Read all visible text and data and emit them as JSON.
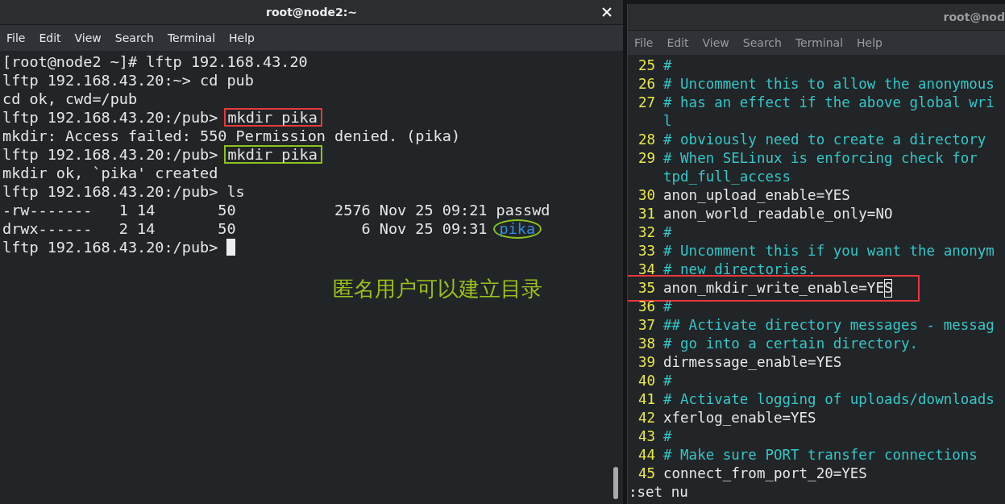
{
  "left_window": {
    "title": "root@node2:~",
    "menu": [
      "File",
      "Edit",
      "View",
      "Search",
      "Terminal",
      "Help"
    ],
    "lines": [
      {
        "text": "[root@node2 ~]# lftp 192.168.43.20"
      },
      {
        "text": "lftp 192.168.43.20:~> cd pub"
      },
      {
        "text": "cd ok, cwd=/pub"
      },
      {
        "text": "lftp 192.168.43.20:/pub> ",
        "command": "mkdir pika",
        "color": "#e8383d"
      },
      {
        "text": "mkdir: Access failed: 550 Permission denied. (pika)"
      },
      {
        "text": "lftp 192.168.43.20:/pub> ",
        "command": "mkdir pika",
        "color": "#8cc21e"
      },
      {
        "text": "mkdir ok, `pika' created"
      },
      {
        "text": "lftp 192.168.43.20:/pub> ls"
      },
      {
        "text": "-rw-------   1 14       50           2576 Nov 25 09:21 passwd"
      },
      {
        "text": "drwx------   2 14       50              6 Nov 25 09:31 ",
        "entry": "pika",
        "color": "#8cc21e"
      },
      {
        "text": "lftp 192.168.43.20:/pub> ",
        "cursor": true
      }
    ],
    "annotation": "匿名用户可以建立目录"
  },
  "right_window": {
    "title": "root@nod",
    "menu": [
      "File",
      "Edit",
      "View",
      "Search",
      "Terminal",
      "Help"
    ],
    "lines": [
      {
        "num": "25",
        "kind": "comment",
        "text": "#"
      },
      {
        "num": "26",
        "kind": "comment",
        "text": "# Uncomment this to allow the anonymous"
      },
      {
        "num": "27",
        "kind": "comment",
        "text": "# has an effect if the above global wri",
        "wrap": "l"
      },
      {
        "num": "28",
        "kind": "comment",
        "text": "# obviously need to create a directory"
      },
      {
        "num": "29",
        "kind": "comment",
        "text": "# When SELinux is enforcing check for",
        "wrap": "tpd_full_access"
      },
      {
        "num": "30",
        "kind": "setting",
        "text": "anon_upload_enable=YES"
      },
      {
        "num": "31",
        "kind": "setting",
        "text": "anon_world_readable_only=NO"
      },
      {
        "num": "32",
        "kind": "comment",
        "text": "#"
      },
      {
        "num": "33",
        "kind": "comment",
        "text": "# Uncomment this if you want the anonym"
      },
      {
        "num": "34",
        "kind": "comment",
        "text": "# new directories."
      },
      {
        "num": "35",
        "kind": "setting",
        "text": "anon_mkdir_write_enable=YE",
        "cursor_text": "S",
        "color": "#e8383d"
      },
      {
        "num": "36",
        "kind": "comment",
        "text": "#"
      },
      {
        "num": "37",
        "kind": "comment",
        "text": "## Activate directory messages - messag"
      },
      {
        "num": "38",
        "kind": "comment",
        "text": "# go into a certain directory."
      },
      {
        "num": "39",
        "kind": "setting",
        "text": "dirmessage_enable=YES"
      },
      {
        "num": "40",
        "kind": "comment",
        "text": "#"
      },
      {
        "num": "41",
        "kind": "comment",
        "text": "# Activate logging of uploads/downloads"
      },
      {
        "num": "42",
        "kind": "setting",
        "text": "xferlog_enable=YES"
      },
      {
        "num": "43",
        "kind": "comment",
        "text": "#"
      },
      {
        "num": "44",
        "kind": "comment",
        "text": "# Make sure PORT transfer connections"
      },
      {
        "num": "45",
        "kind": "setting",
        "text": "connect_from_port_20=YES"
      }
    ],
    "command_line": ":set nu"
  }
}
